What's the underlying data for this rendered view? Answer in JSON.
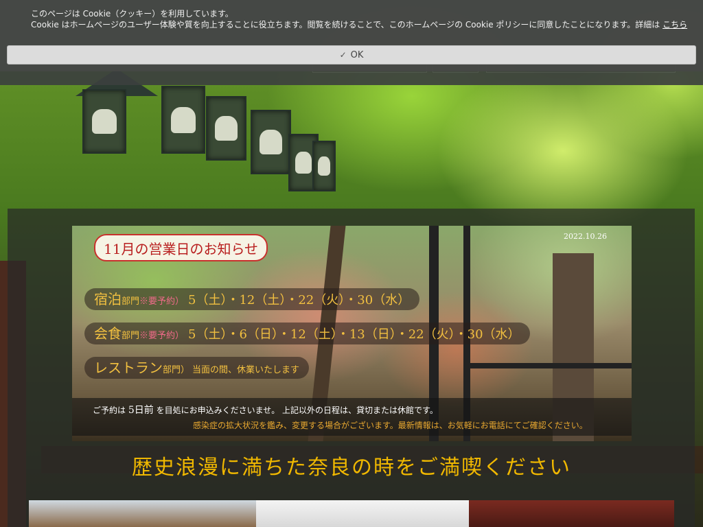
{
  "cookie": {
    "line1": "このページは Cookie（クッキー）を利用しています。",
    "line2": "Cookie はホームページのユーザー体験や質を向上することに役立ちます。閲覧を続けることで、このホームページの Cookie ポリシーに同意したことになります。詳細は",
    "link": "こちら",
    "ok_label": "OK",
    "ok_icon": "check-icon"
  },
  "notice": {
    "date": "2022.10.26",
    "title": "11月の営業日のお知らせ",
    "rows": [
      {
        "name": "宿泊",
        "dept": "部門",
        "note": "※要予約）",
        "days": "5（土）・12（土）・22（火）・30（水）"
      },
      {
        "name": "会食",
        "dept": "部門",
        "note": "※要予約）",
        "days": "5（土）・6（日）・12（土）・13（日）・22（火）・30（水）"
      },
      {
        "name": "レストラン",
        "dept": "部門）",
        "note": "",
        "days": "当面の間、休業いたします"
      }
    ],
    "bottom1_pre": "ご予約は",
    "bottom1_emph": "5日前",
    "bottom1_post": "を目処にお申込みくださいませ。 上記以外の日程は、貸切または休館です。",
    "bottom2": "感染症の拡大状況を鑑み、変更する場合がございます。最新情報は、お気軽にお電話にてご確認ください。"
  },
  "catch_copy": "歴史浪漫に満ちた奈良の時をご満喫ください"
}
